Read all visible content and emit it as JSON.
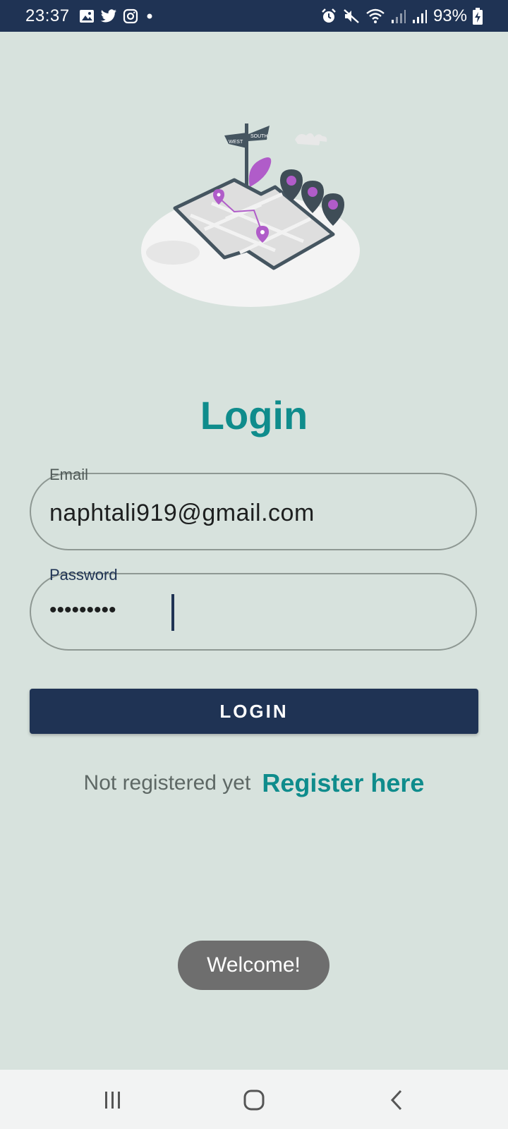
{
  "status_bar": {
    "time": "23:37",
    "battery": "93%",
    "left_icons": [
      "image-icon",
      "twitter-icon",
      "instagram-icon",
      "dot-icon"
    ],
    "right_icons": [
      "alarm-icon",
      "mute-icon",
      "wifi-icon",
      "signal-icon",
      "signal-icon",
      "battery-charging-icon"
    ]
  },
  "illustration": {
    "sign_left": "WEST",
    "sign_right": "SOUTH"
  },
  "title": "Login",
  "email": {
    "label": "Email",
    "value": "naphtali919@gmail.com"
  },
  "password": {
    "label": "Password",
    "masked_value": "•••••••••"
  },
  "login_button": "LOGIN",
  "register": {
    "prompt": "Not registered yet",
    "link": "Register here"
  },
  "toast": "Welcome!",
  "nav_bar": {
    "icons": [
      "recent-apps-icon",
      "home-icon",
      "back-icon"
    ]
  },
  "colors": {
    "background": "#d7e2dd",
    "accent": "#0f8c8c",
    "primary": "#1f3354",
    "illustration_purple": "#b05cc9"
  }
}
